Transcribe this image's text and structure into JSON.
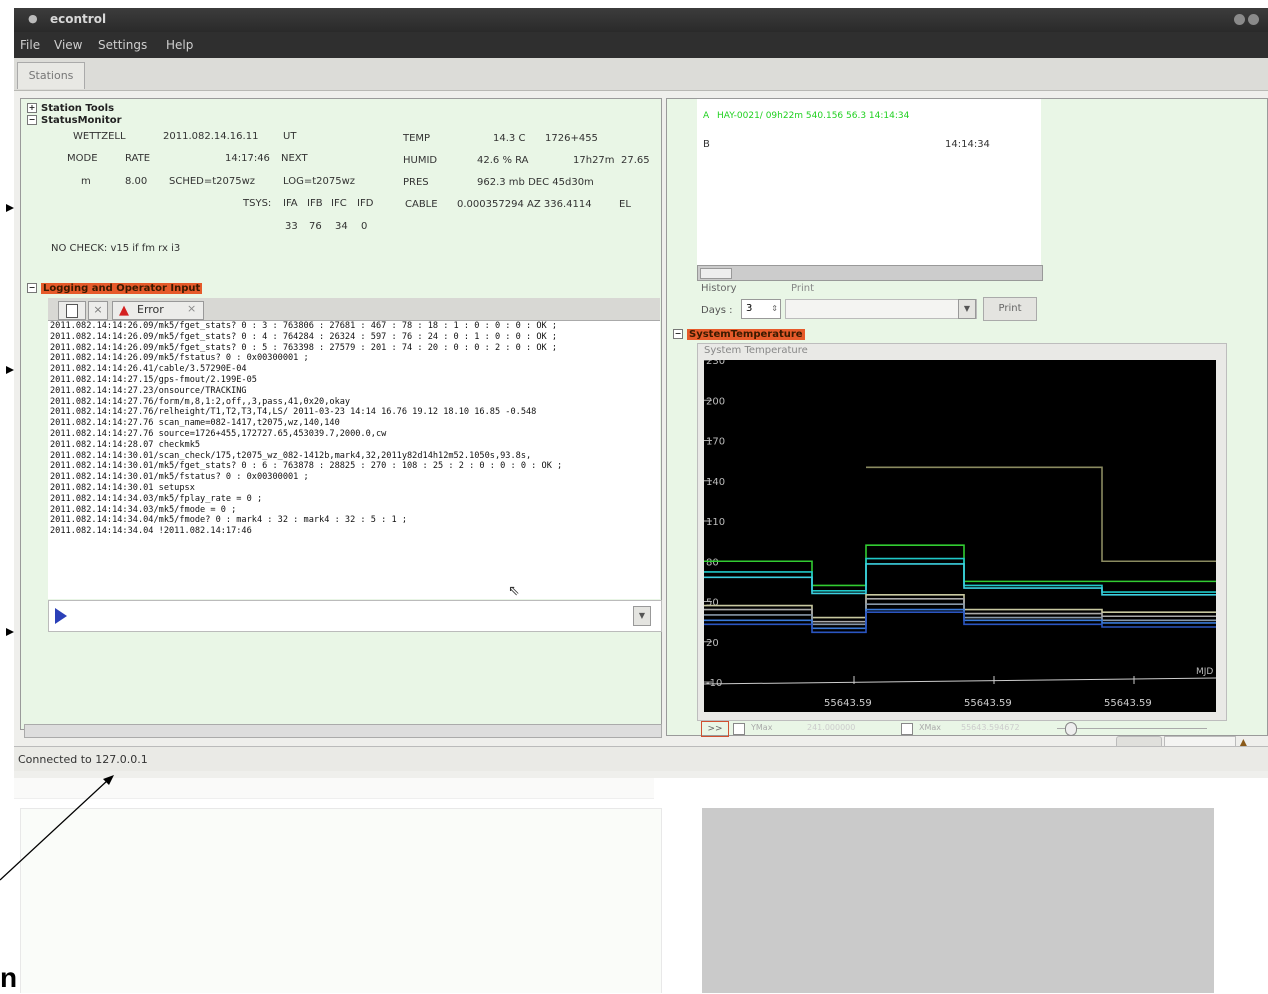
{
  "window": {
    "title": "econtrol"
  },
  "menu": [
    "File",
    "View",
    "Settings",
    "Help"
  ],
  "tabs": [
    "Stations"
  ],
  "tree": {
    "station_tools": "Station Tools",
    "status_monitor": "StatusMonitor",
    "logging": "Logging and Operator Input",
    "system_temp": "SystemTemperature"
  },
  "status": {
    "station": "WETTZELL",
    "time": "2011.082.14.16.11",
    "ut": "UT",
    "mode_lbl": "MODE",
    "rate_lbl": "RATE",
    "next_time": "14:17:46",
    "next": "NEXT",
    "mode": "m",
    "rate": "8.00",
    "sched": "SCHED=t2075wz",
    "log": "LOG=t2075wz",
    "tsys_lbl": "TSYS:",
    "ifa": "IFA",
    "ifb": "IFB",
    "ifc": "IFC",
    "ifd": "IFD",
    "tsys_a": "33",
    "tsys_b": "76",
    "tsys_c": "34",
    "tsys_d": "0",
    "temp_lbl": "TEMP",
    "temp": "14.3 C",
    "temp_src": "1726+455",
    "humid_lbl": "HUMID",
    "humid": "42.6 % RA",
    "ra": "17h27m",
    "ra2": "27.65",
    "pres_lbl": "PRES",
    "pres": "962.3 mb DEC 45d30m",
    "cable_lbl": "CABLE",
    "cable": "0.000357294 AZ 336.4114",
    "el": "EL",
    "nocheck": "NO CHECK: v15 if fm rx i3"
  },
  "log_tabs": {
    "error": "Error"
  },
  "log_lines": [
    "2011.082.14:14:26.09/mk5/fget_stats? 0 : 3 : 763806 : 27681 : 467 : 78 : 18 : 1 : 0 : 0 : 0 : OK ;",
    "2011.082.14:14:26.09/mk5/fget_stats? 0 : 4 : 764284 : 26324 : 597 : 76 : 24 : 0 : 1 : 0 : 0 : OK ;",
    "2011.082.14:14:26.09/mk5/fget_stats? 0 : 5 : 763398 : 27579 : 201 : 74 : 20 : 0 : 0 : 2 : 0 : OK ;",
    "2011.082.14:14:26.09/mk5/fstatus? 0 : 0x00300001 ;",
    "2011.082.14:14:26.41/cable/3.57290E-04",
    "2011.082.14:14:27.15/gps-fmout/2.199E-05",
    "2011.082.14:14:27.23/onsource/TRACKING",
    "2011.082.14:14:27.76/form/m,8,1:2,off,,3,pass,41,0x20,okay",
    "2011.082.14:14:27.76/relheight/T1,T2,T3,T4,LS/ 2011-03-23  14:14  16.76  19.12  18.10  16.85  -0.548",
    "2011.082.14:14:27.76 scan_name=082-1417,t2075,wz,140,140",
    "2011.082.14:14:27.76 source=1726+455,172727.65,453039.7,2000.0,cw",
    "2011.082.14:14:28.07 checkmk5",
    "2011.082.14:14:30.01/scan_check/175,t2075_wz_082-1412b,mark4,32,2011y82d14h12m52.1050s,93.8s,",
    "2011.082.14:14:30.01/mk5/fget_stats? 0 : 6 : 763878 : 28825 : 270 : 108 : 25 : 2 : 0 : 0 : 0 : OK ;",
    "2011.082.14:14:30.01/mk5/fstatus? 0 : 0x00300001 ;",
    "2011.082.14:14:30.01 setupsx",
    "2011.082.14:14:34.03/mk5/fplay_rate = 0 ;",
    "2011.082.14:14:34.03/mk5/fmode = 0 ;",
    "2011.082.14:14:34.04/mk5/fmode? 0 : mark4 : 32 : mark4 : 32 : 5 : 1 ;",
    "2011.082.14:14:34.04 !2011.082.14:17:46"
  ],
  "schedule": {
    "a_label": "A",
    "a_text": "HAY-0021/  09h22m     540.156   56.3   14:14:34",
    "b_label": "B",
    "b_time": "14:14:34"
  },
  "history": {
    "history_lbl": "History",
    "print_lbl": "Print",
    "days_lbl": "Days :",
    "days_val": "3",
    "print_btn": "Print"
  },
  "chart_data": {
    "type": "line",
    "title": "System Temperature",
    "xlabel": "MJD",
    "ylim": [
      -10,
      230
    ],
    "yticks": [
      230,
      200,
      170,
      140,
      110,
      80,
      50,
      20,
      -10
    ],
    "xtick_labels": [
      "55643.59",
      "55643.59",
      "55643.59"
    ],
    "series": [
      {
        "color": "#32cc32",
        "values": [
          80,
          62,
          92,
          65,
          65
        ]
      },
      {
        "color": "#20c8c8",
        "values": [
          72,
          58,
          82,
          62,
          57
        ]
      },
      {
        "color": "#3ccfe0",
        "values": [
          68,
          56,
          78,
          60,
          55
        ]
      },
      {
        "color": "#c8c8a0",
        "values": [
          47,
          38,
          55,
          44,
          42
        ]
      },
      {
        "color": "#aaaaaa",
        "values": [
          44,
          35,
          52,
          41,
          39
        ]
      },
      {
        "color": "#8898a8",
        "values": [
          40,
          33,
          48,
          38,
          36
        ]
      },
      {
        "color": "#3a7ad8",
        "values": [
          36,
          30,
          44,
          36,
          34
        ]
      },
      {
        "color": "#2a55c0",
        "values": [
          33,
          27,
          42,
          33,
          31
        ]
      },
      {
        "color": "#8a8a60",
        "values": [
          null,
          null,
          150,
          150,
          80
        ]
      }
    ]
  },
  "chart_controls": {
    "btn": ">>",
    "ymax_lbl": "YMax",
    "ymax": "241.000000",
    "xmax_lbl": "XMax",
    "xmax": "55643.594672"
  },
  "statusbar": {
    "text": "Connected to 127.0.0.1"
  },
  "caption": {
    "letter": "n"
  }
}
